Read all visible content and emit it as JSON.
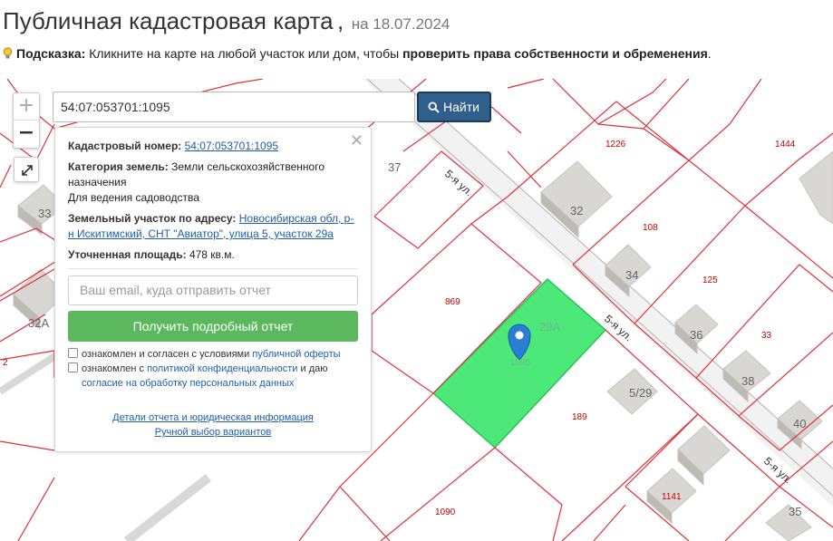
{
  "header": {
    "title": "Публичная кадастровая карта",
    "separator": ",",
    "date": "на 18.07.2024"
  },
  "hint": {
    "label": "Подсказка:",
    "text": "Кликните на карте на любой участок или дом, чтобы",
    "emphasis": "проверить права собственности и обременения",
    "end": "."
  },
  "map": {
    "zoom_in": "+",
    "zoom_out": "−",
    "search": {
      "value": "54:07:053701:1095"
    },
    "find_button": "Найти",
    "labels": {
      "n37": "37",
      "n33": "33",
      "n32a": "32А",
      "n32": "32",
      "n34": "34",
      "n36": "36",
      "n38": "38",
      "n40": "40",
      "n35": "35",
      "n29a": "29А",
      "n5_29": "5/29",
      "r1226": "1226",
      "r1444": "1444",
      "r108": "108",
      "r125": "125",
      "r33": "33",
      "r869": "869",
      "r1095": "1095",
      "r189": "189",
      "r1090": "1090",
      "r1141": "1141",
      "r2": "2"
    },
    "streets": {
      "s1": "5-я ул.",
      "s2": "5-я ул.",
      "s3": "5-я ул."
    }
  },
  "popup": {
    "close": "✕",
    "cad_label": "Кадастровый номер:",
    "cad_value": "54:07:053701:1095",
    "category_label": "Категория земель:",
    "category_value": "Земли сельскохозяйственного назначения",
    "usage": "Для ведения садоводства",
    "address_label": "Земельный участок по адресу:",
    "address_value": "Новосибирская обл, р-н Искитимский, СНТ \"Авиатор\", улица 5, участок 29а",
    "area_label": "Уточненная площадь:",
    "area_value": "478 кв.м.",
    "email_placeholder": "Ваш email, куда отправить отчет",
    "get_button": "Получить подробный отчет",
    "check1_text": "ознакомлен и согласен с условиями",
    "check1_link": "публичной оферты",
    "check2_text": "ознакомлен с",
    "check2_link": "политикой конфиденциальности",
    "check2_and": "и даю",
    "check2_link2": "согласие на обработку персональных данных",
    "details_link": "Детали отчета и юридическая информация",
    "manual_link": "Ручной выбор вариантов"
  },
  "colors": {
    "selected_parcel": "#4de87a",
    "boundary": "#e0303a",
    "button": "#2f5f8a",
    "green_button": "#5cb85c"
  }
}
